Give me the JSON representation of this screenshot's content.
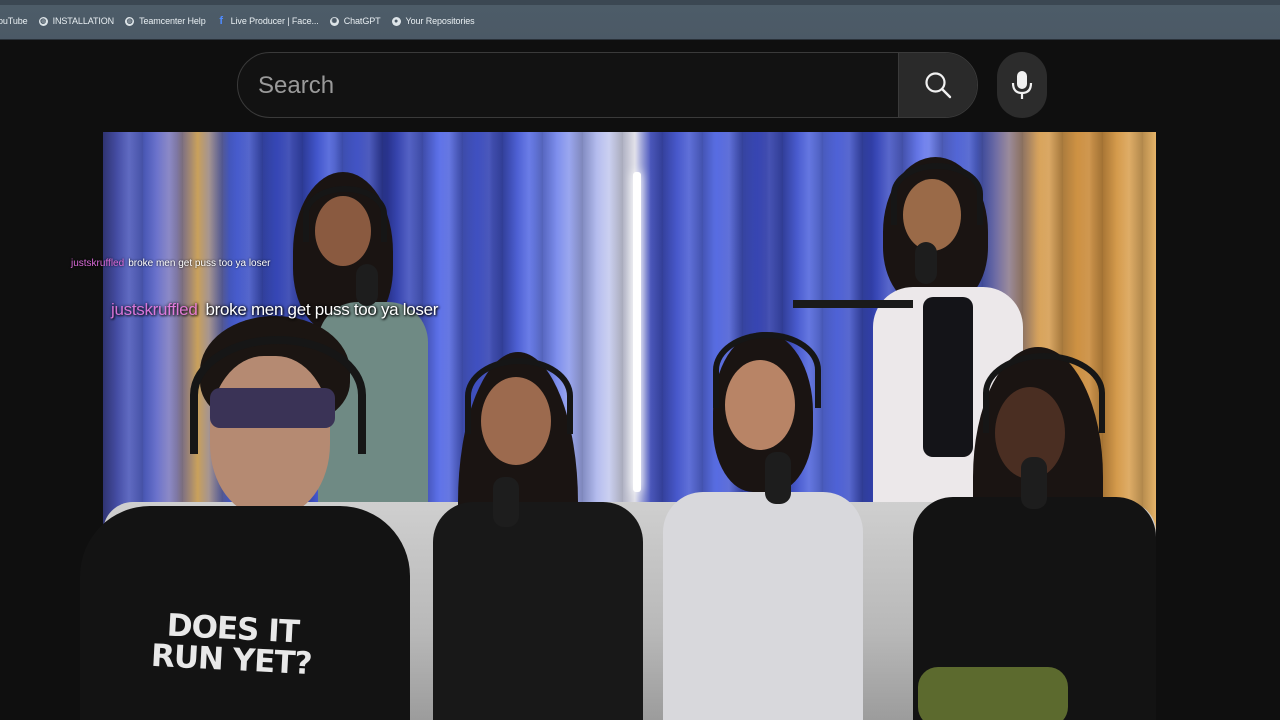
{
  "bookmarks": [
    {
      "label": "ouTube",
      "icon": "youtube-icon"
    },
    {
      "label": "INSTALLATION",
      "icon": "globe-icon"
    },
    {
      "label": "Teamcenter Help",
      "icon": "globe-icon"
    },
    {
      "label": "Live Producer | Face...",
      "icon": "facebook-icon"
    },
    {
      "label": "ChatGPT",
      "icon": "chatgpt-icon"
    },
    {
      "label": "Your Repositories",
      "icon": "github-icon"
    }
  ],
  "search": {
    "placeholder": "Search",
    "value": ""
  },
  "icons": {
    "search_button": "search-icon",
    "voice_button": "microphone-icon"
  },
  "video": {
    "shirt_text": "DOES IT RUN YET?"
  },
  "chat": {
    "small": {
      "user": "justskruffled",
      "message": "broke men get puss too ya loser"
    },
    "big": {
      "user": "justskruffled",
      "message": "broke men get puss too ya loser"
    }
  },
  "colors": {
    "background": "#0f0f0f",
    "bookmark_bar": "#4b5966",
    "chat_username": "#e070d8"
  }
}
